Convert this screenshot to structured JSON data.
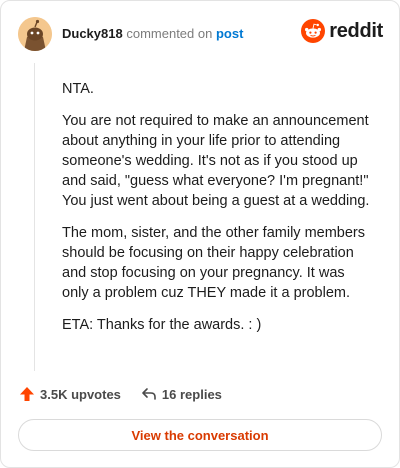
{
  "header": {
    "username": "Ducky818",
    "verb": "commented on",
    "post_link": "post",
    "logo_text": "reddit"
  },
  "comment": {
    "paragraphs": [
      "NTA.",
      "You are not required to make an announcement about anything in your life prior to attending someone's wedding. It's not as if you stood up and said, \"guess what everyone? I'm pregnant!\" You just went about being a guest at a wedding.",
      "The mom, sister, and the other family members should be focusing on their happy celebration and stop focusing on your pregnancy. It was only a problem cuz THEY made it a problem.",
      "ETA: Thanks for the awards. : )"
    ]
  },
  "actions": {
    "upvotes": "3.5K upvotes",
    "replies": "16 replies"
  },
  "cta": {
    "label": "View the conversation"
  },
  "colors": {
    "reddit_orange": "#ff4500",
    "link_blue": "#0079d3",
    "cta_text": "#d93a00"
  }
}
